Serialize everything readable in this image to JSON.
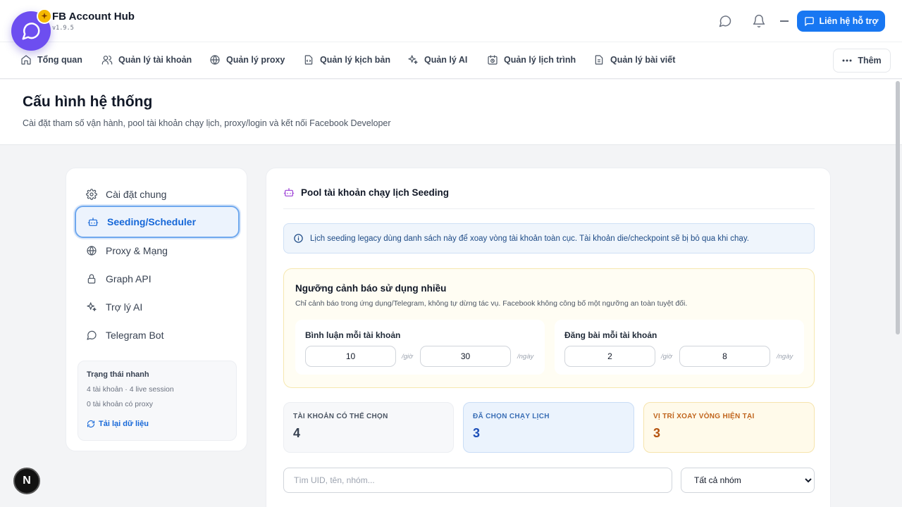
{
  "app": {
    "title": "FB Account Hub",
    "version": "v1.9.5"
  },
  "header": {
    "support_label": "Liên hệ hỗ trợ"
  },
  "nav": {
    "items": [
      {
        "label": "Tổng quan",
        "icon": "home-icon"
      },
      {
        "label": "Quản lý tài khoản",
        "icon": "users-icon"
      },
      {
        "label": "Quản lý proxy",
        "icon": "globe-icon"
      },
      {
        "label": "Quản lý kịch bản",
        "icon": "file-code-icon"
      },
      {
        "label": "Quản lý AI",
        "icon": "sparkles-icon"
      },
      {
        "label": "Quản lý lịch trình",
        "icon": "calendar-clock-icon"
      },
      {
        "label": "Quản lý bài viết",
        "icon": "file-text-icon"
      }
    ],
    "more_label": "Thêm"
  },
  "page": {
    "title": "Cấu hình hệ thống",
    "subtitle": "Cài đặt tham số vận hành, pool tài khoản chạy lịch, proxy/login và kết nối Facebook Developer"
  },
  "sidebar": {
    "items": [
      {
        "label": "Cài đặt chung",
        "icon": "gear-icon"
      },
      {
        "label": "Seeding/Scheduler",
        "icon": "bot-icon",
        "active": true
      },
      {
        "label": "Proxy & Mạng",
        "icon": "globe-icon"
      },
      {
        "label": "Graph API",
        "icon": "lock-icon"
      },
      {
        "label": "Trợ lý AI",
        "icon": "sparkles-icon"
      },
      {
        "label": "Telegram Bot",
        "icon": "message-icon"
      }
    ],
    "quick": {
      "title": "Trạng thái nhanh",
      "line1": "4 tài khoản · 4 live session",
      "line2": "0 tài khoản có proxy",
      "reload_label": "Tải lại dữ liệu"
    }
  },
  "main": {
    "title": "Pool tài khoản chạy lịch Seeding",
    "info": "Lịch seeding legacy dùng danh sách này để xoay vòng tài khoản toàn cục. Tài khoản die/checkpoint sẽ bị bỏ qua khi chạy.",
    "warning": {
      "title": "Ngưỡng cảnh báo sử dụng nhiều",
      "subtitle": "Chỉ cảnh báo trong ứng dụng/Telegram, không tự dừng tác vụ. Facebook không công bố một ngưỡng an toàn tuyệt đối.",
      "comment": {
        "label": "Bình luận mỗi tài khoản",
        "per_hour": "10",
        "per_day": "30"
      },
      "post": {
        "label": "Đăng bài mỗi tài khoản",
        "per_hour": "2",
        "per_day": "8"
      },
      "unit_hour": "/giờ",
      "unit_day": "/ngày"
    },
    "stats": [
      {
        "label": "TÀI KHOẢN CÓ THỂ CHỌN",
        "value": "4"
      },
      {
        "label": "ĐÃ CHỌN CHẠY LỊCH",
        "value": "3"
      },
      {
        "label": "VỊ TRÍ XOAY VÒNG HIỆN TẠI",
        "value": "3"
      }
    ],
    "search_placeholder": "Tìm UID, tên, nhóm...",
    "group_filter": "Tất cả nhóm"
  },
  "dev_badge": "N",
  "colors": {
    "primary": "#1877f2",
    "accent_purple": "#6d4ef0"
  }
}
